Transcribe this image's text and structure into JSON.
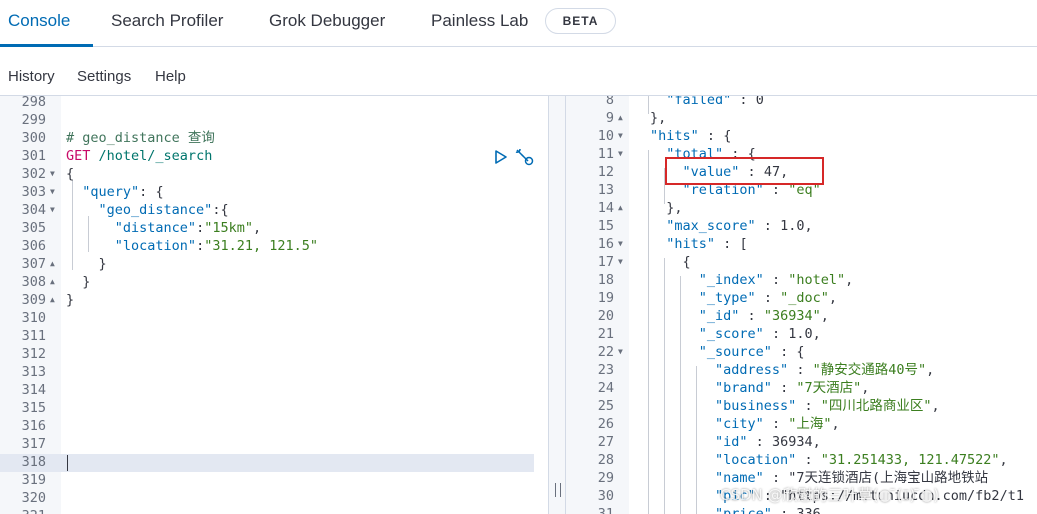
{
  "tabs": [
    {
      "label": "Console",
      "active": true
    },
    {
      "label": "Search Profiler",
      "active": false
    },
    {
      "label": "Grok Debugger",
      "active": false
    },
    {
      "label": "Painless Lab",
      "active": false
    }
  ],
  "beta_badge": "BETA",
  "menu": {
    "history": "History",
    "settings": "Settings",
    "help": "Help"
  },
  "request_lines": [
    {
      "num": "298",
      "fold": "",
      "code": ""
    },
    {
      "num": "299",
      "fold": "",
      "code": ""
    },
    {
      "num": "300",
      "fold": "",
      "code": "# geo_distance 查询"
    },
    {
      "num": "301",
      "fold": "",
      "code": "GET /hotel/_search"
    },
    {
      "num": "302",
      "fold": "▼",
      "code": "{"
    },
    {
      "num": "303",
      "fold": "▼",
      "code": "  \"query\": {"
    },
    {
      "num": "304",
      "fold": "▼",
      "code": "    \"geo_distance\":{"
    },
    {
      "num": "305",
      "fold": "",
      "code": "      \"distance\":\"15km\","
    },
    {
      "num": "306",
      "fold": "",
      "code": "      \"location\":\"31.21, 121.5\""
    },
    {
      "num": "307",
      "fold": "▲",
      "code": "    }"
    },
    {
      "num": "308",
      "fold": "▲",
      "code": "  }"
    },
    {
      "num": "309",
      "fold": "▲",
      "code": "}"
    },
    {
      "num": "310",
      "fold": "",
      "code": ""
    },
    {
      "num": "311",
      "fold": "",
      "code": ""
    },
    {
      "num": "312",
      "fold": "",
      "code": ""
    },
    {
      "num": "313",
      "fold": "",
      "code": ""
    },
    {
      "num": "314",
      "fold": "",
      "code": ""
    },
    {
      "num": "315",
      "fold": "",
      "code": ""
    },
    {
      "num": "316",
      "fold": "",
      "code": ""
    },
    {
      "num": "317",
      "fold": "",
      "code": ""
    },
    {
      "num": "318",
      "fold": "",
      "code": ""
    },
    {
      "num": "319",
      "fold": "",
      "code": ""
    },
    {
      "num": "320",
      "fold": "",
      "code": ""
    },
    {
      "num": "321",
      "fold": "",
      "code": ""
    }
  ],
  "response_lines": [
    {
      "num": "8",
      "fold": "",
      "code": "  \"failed\" : 0"
    },
    {
      "num": "9",
      "fold": "▲",
      "code": "},"
    },
    {
      "num": "10",
      "fold": "▼",
      "code": "\"hits\" : {"
    },
    {
      "num": "11",
      "fold": "▼",
      "code": "  \"total\" : {"
    },
    {
      "num": "12",
      "fold": "",
      "code": "    \"value\" : 47,"
    },
    {
      "num": "13",
      "fold": "",
      "code": "    \"relation\" : \"eq\""
    },
    {
      "num": "14",
      "fold": "▲",
      "code": "  },"
    },
    {
      "num": "15",
      "fold": "",
      "code": "  \"max_score\" : 1.0,"
    },
    {
      "num": "16",
      "fold": "▼",
      "code": "  \"hits\" : ["
    },
    {
      "num": "17",
      "fold": "▼",
      "code": "    {"
    },
    {
      "num": "18",
      "fold": "",
      "code": "      \"_index\" : \"hotel\","
    },
    {
      "num": "19",
      "fold": "",
      "code": "      \"_type\" : \"_doc\","
    },
    {
      "num": "20",
      "fold": "",
      "code": "      \"_id\" : \"36934\","
    },
    {
      "num": "21",
      "fold": "",
      "code": "      \"_score\" : 1.0,"
    },
    {
      "num": "22",
      "fold": "▼",
      "code": "      \"_source\" : {"
    },
    {
      "num": "23",
      "fold": "",
      "code": "        \"address\" : \"静安交通路40号\","
    },
    {
      "num": "24",
      "fold": "",
      "code": "        \"brand\" : \"7天酒店\","
    },
    {
      "num": "25",
      "fold": "",
      "code": "        \"business\" : \"四川北路商业区\","
    },
    {
      "num": "26",
      "fold": "",
      "code": "        \"city\" : \"上海\","
    },
    {
      "num": "27",
      "fold": "",
      "code": "        \"id\" : 36934,"
    },
    {
      "num": "28",
      "fold": "",
      "code": "        \"location\" : \"31.251433, 121.47522\","
    },
    {
      "num": "29",
      "fold": "",
      "code": "        \"name\" : \"7天连锁酒店(上海宝山路地铁站"
    },
    {
      "num": "30",
      "fold": "",
      "code": "        \"pic\" : \"https://m.tuniucdn.com/fb2/t1"
    },
    {
      "num": "31",
      "fold": "",
      "code": "        \"price\" : 336,"
    }
  ],
  "watermark": "CSDN @欣慰的三叶草(● ̄(ｴ) ̄●)",
  "colors": {
    "accent": "#006bb4",
    "highlight_box": "#d62828",
    "active_line": "#e3e8f2"
  }
}
